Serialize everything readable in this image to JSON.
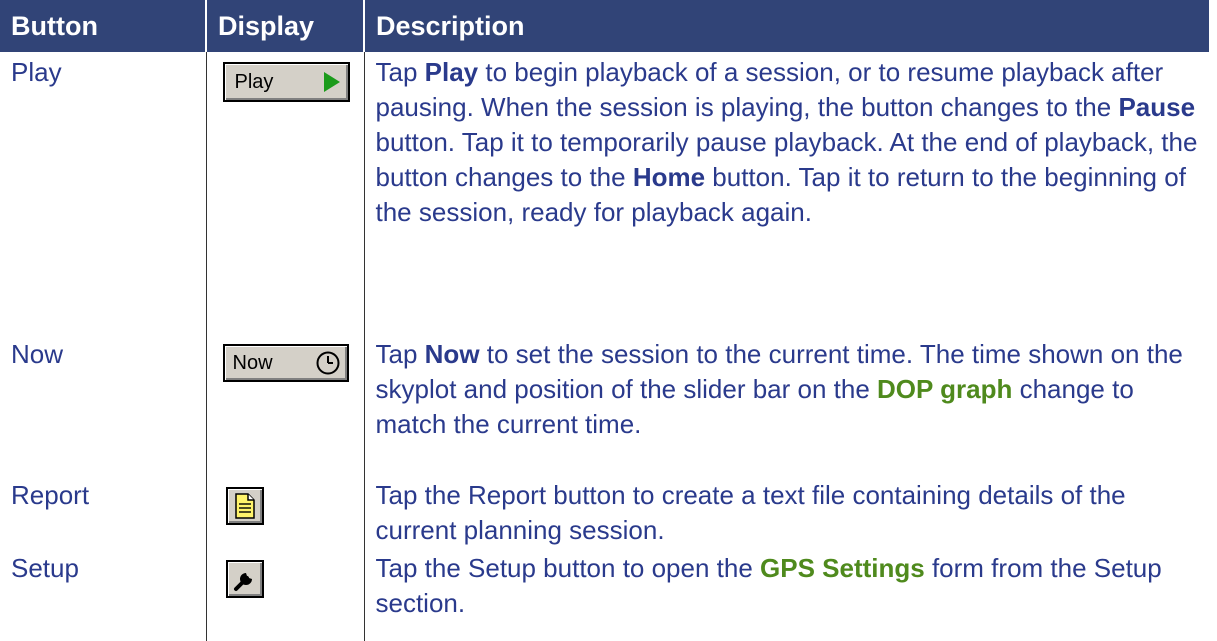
{
  "columns": {
    "button": "Button",
    "display": "Display",
    "description": "Description"
  },
  "colors": {
    "header_bg": "#314477",
    "text": "#2a3a8c",
    "link": "#4f8a1d",
    "button_face": "#d4d0c8",
    "play_arrow": "#1b9b1b"
  },
  "rows": [
    {
      "name": "Play",
      "display": {
        "label": "Play",
        "icon": "play-triangle-icon"
      },
      "description": {
        "s1": "Tap ",
        "k1": "Play",
        "s2": " to begin playback of a session, or to resume playback after pausing. When the session is playing, the button changes to the ",
        "k2": "Pause",
        "s3": " button. Tap it to temporarily pause playback. At the end of playback, the button changes to the ",
        "k3": "Home",
        "s4": " button. Tap it to return to the beginning of the session, ready for playback again."
      }
    },
    {
      "name": "Now",
      "display": {
        "label": "Now",
        "icon": "clock-icon"
      },
      "description": {
        "s1": "Tap ",
        "k1": "Now",
        "s2": " to set the session to the current time. The time shown on the skyplot and position of the slider bar on the ",
        "link1": "DOP graph",
        "s3": " change to match the current time."
      }
    },
    {
      "name": "Report",
      "display": {
        "icon": "report-document-icon"
      },
      "description": {
        "s1": "Tap the Report button to create a text file containing details of the current planning session."
      }
    },
    {
      "name": "Setup",
      "display": {
        "icon": "wrench-icon"
      },
      "description": {
        "s1": "Tap the Setup button to open the ",
        "link1": "GPS Settings",
        "s2": " form from the Setup section."
      }
    }
  ]
}
